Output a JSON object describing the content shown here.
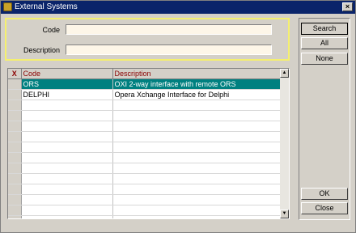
{
  "window": {
    "title": "External Systems",
    "close_glyph": "×"
  },
  "search": {
    "code_label": "Code",
    "code_value": "",
    "description_label": "Description",
    "description_value": ""
  },
  "grid": {
    "columns": [
      "X",
      "Code",
      "Description"
    ],
    "rows": [
      {
        "code": "ORS",
        "description": "OXI 2-way interface with remote ORS",
        "selected": true
      },
      {
        "code": "DELPHI",
        "description": "Opera Xchange Interface for Delphi",
        "selected": false
      }
    ],
    "empty_rows": 12
  },
  "buttons": {
    "search": "Search",
    "all": "All",
    "none": "None",
    "ok": "OK",
    "close": "Close"
  },
  "colors": {
    "selection": "#008080",
    "panel_border": "#f5f06e",
    "header_text": "#8b0000",
    "titlebar": "#0a246a"
  }
}
